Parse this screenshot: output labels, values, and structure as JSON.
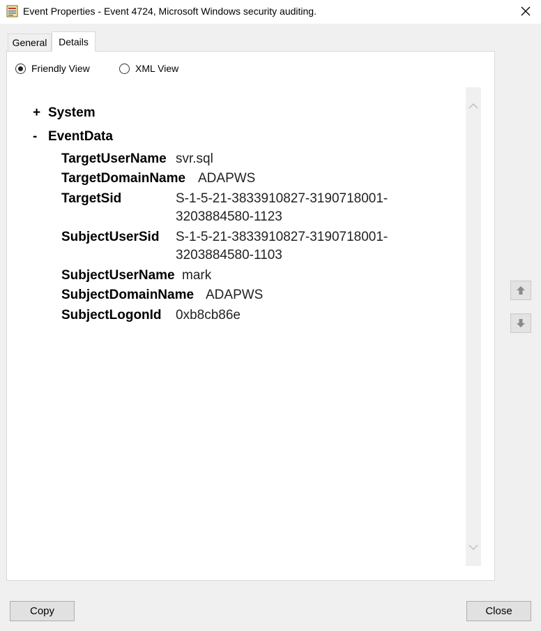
{
  "window": {
    "title": "Event Properties - Event 4724, Microsoft Windows security auditing.",
    "close_glyph": "✕"
  },
  "tabs": [
    {
      "label": "General",
      "selected": false
    },
    {
      "label": "Details",
      "selected": true
    }
  ],
  "view_mode": {
    "friendly_label": "Friendly View",
    "xml_label": "XML View",
    "selected": "friendly"
  },
  "tree": {
    "system": {
      "toggle": "+",
      "label": "System"
    },
    "eventdata": {
      "toggle": "-",
      "label": "EventData"
    },
    "fields": [
      {
        "name": "TargetUserName",
        "value": "svr.sql"
      },
      {
        "name": "TargetDomainName",
        "value": "ADAPWS"
      },
      {
        "name": "TargetSid",
        "value_line1": "S-1-5-21-3833910827-3190718001-",
        "value_line2": "3203884580-1123"
      },
      {
        "name": "SubjectUserSid",
        "value_line1": "S-1-5-21-3833910827-3190718001-",
        "value_line2": "3203884580-1103"
      },
      {
        "name": "SubjectUserName",
        "value": "mark"
      },
      {
        "name": "SubjectDomainName",
        "value": "ADAPWS"
      },
      {
        "name": "SubjectLogonId",
        "value": "0xb8cb86e"
      }
    ]
  },
  "buttons": {
    "copy": "Copy",
    "close": "Close"
  },
  "icons": {
    "app": "event-viewer-icon",
    "scroll_up": "chevron-up-icon",
    "scroll_down": "chevron-down-icon",
    "prev": "arrow-up-icon",
    "next": "arrow-down-icon"
  }
}
